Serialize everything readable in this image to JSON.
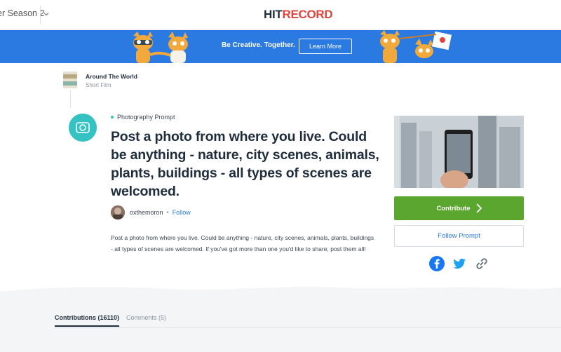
{
  "header": {
    "season_label": "er Season 2",
    "logo_hit": "HIT",
    "logo_record": "RECORD"
  },
  "banner": {
    "tagline": "Be Creative. Together.",
    "cta_label": "Learn More",
    "color": "#2a7ae2"
  },
  "project": {
    "title": "Around The World",
    "type": "Short Film"
  },
  "prompt": {
    "category": "Photography Prompt",
    "headline": "Post a photo from where you live. Could be anything - nature, city scenes, animals, plants, buildings - all types of scenes are welcomed.",
    "author": "oxthemoron",
    "follow_label": "Follow",
    "description": "Post a photo from where you live. Could be anything - nature, city scenes, animals, plants, buildings - all types of scenes are welcomed. If you've got more than one you'd like to share, post them all!"
  },
  "actions": {
    "contribute_label": "Contribute",
    "follow_prompt_label": "Follow Prompt",
    "contribute_color": "#5aa62f"
  },
  "share": {
    "icons": [
      "facebook-icon",
      "twitter-icon",
      "link-icon"
    ]
  },
  "tabs": {
    "contributions": "Contributions (16110)",
    "comments": "Comments (5)"
  },
  "colors": {
    "accent_teal": "#34c2c2",
    "link_blue": "#2a7ae2",
    "logo_red": "#e0443b"
  }
}
